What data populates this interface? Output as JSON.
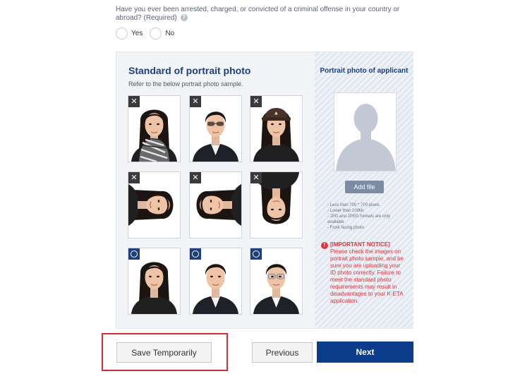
{
  "question": {
    "text": "Have you ever been arrested, charged, or convicted of a criminal offense in your country or abroad?",
    "required": "(Required)",
    "help_icon": "question-help-icon",
    "options": [
      {
        "label": "Yes"
      },
      {
        "label": "No"
      }
    ]
  },
  "standard": {
    "title": "Standard of portrait photo",
    "subtitle": "Refer to the below portrait photo sample.",
    "samples": [
      {
        "status": "bad",
        "description": "scarf"
      },
      {
        "status": "bad",
        "description": "sunglasses"
      },
      {
        "status": "bad",
        "description": "hat"
      },
      {
        "status": "bad",
        "description": "rotated-left"
      },
      {
        "status": "bad",
        "description": "rotated-right"
      },
      {
        "status": "bad",
        "description": "upside-down"
      },
      {
        "status": "good",
        "description": "female"
      },
      {
        "status": "good",
        "description": "male"
      },
      {
        "status": "good",
        "description": "male-glasses"
      }
    ]
  },
  "applicant": {
    "title": "Portrait photo of applicant",
    "add_file_label": "Add file",
    "requirements": [
      "- Less than 700 * 700 pixels",
      "- Lower than 100kb",
      "- JPG and JPEG formats are only available",
      "- Front facing photo"
    ],
    "notice_title": "[IMPORTANT NOTICE]",
    "notice_text": "Please check the images on portrait photo sample, and be sure you are uploading your ID photo correctly. Failure to meet the standard photo requirements may result in disadvantages to your K-ETA application."
  },
  "buttons": {
    "save": "Save Temporarily",
    "previous": "Previous",
    "next": "Next"
  },
  "colors": {
    "brand": "#0b3d8c",
    "title": "#1d3f7e",
    "alert": "#d9363e",
    "highlight": "#d02e33"
  }
}
